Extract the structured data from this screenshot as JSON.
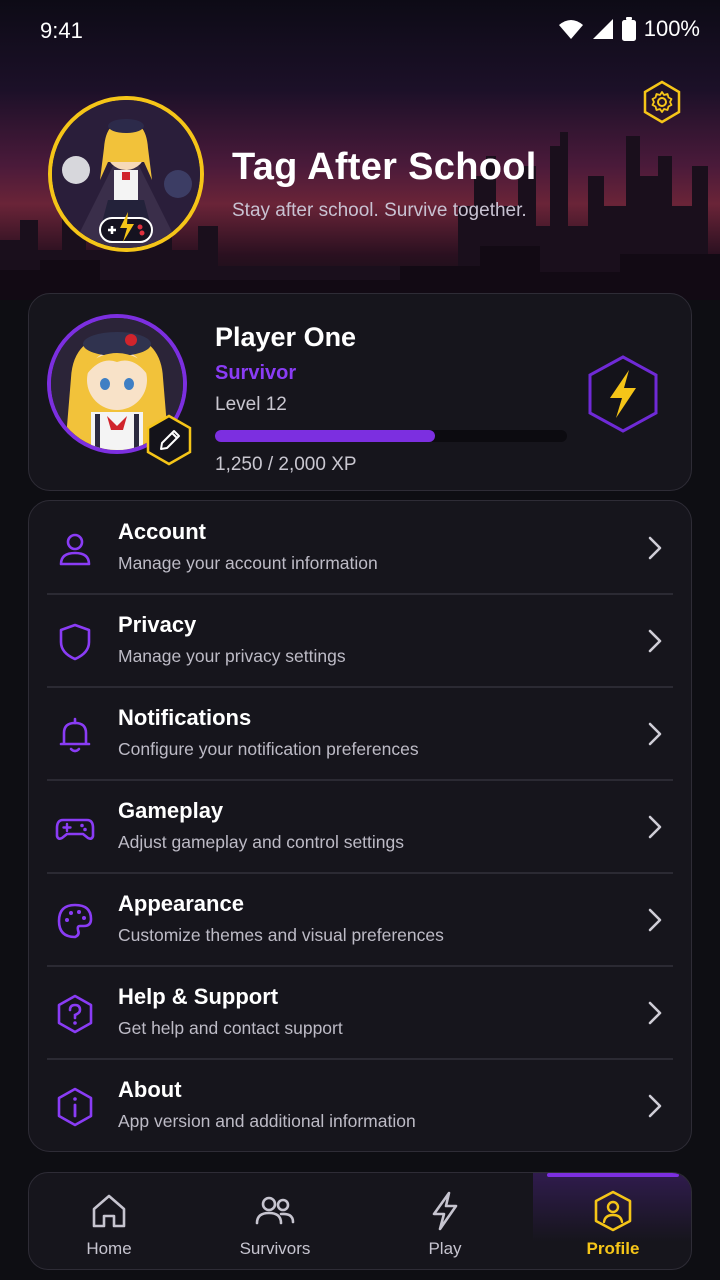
{
  "status_bar": {
    "time": "9:41",
    "battery": "100%"
  },
  "header": {
    "title": "Tag After School",
    "subtitle": "Stay after school. Survive together."
  },
  "profile": {
    "name": "Player One",
    "rank": "Survivor",
    "level": "Level 12",
    "xp_text": "1,250 / 2,000 XP",
    "xp_progress": 0.625
  },
  "settings": [
    {
      "title": "Account",
      "subtitle": "Manage your account information",
      "icon": "user-icon"
    },
    {
      "title": "Privacy",
      "subtitle": "Manage your privacy settings",
      "icon": "shield-icon"
    },
    {
      "title": "Notifications",
      "subtitle": "Configure your notification preferences",
      "icon": "bell-icon"
    },
    {
      "title": "Gameplay",
      "subtitle": "Adjust gameplay and control settings",
      "icon": "gamepad-icon"
    },
    {
      "title": "Appearance",
      "subtitle": "Customize themes and visual preferences",
      "icon": "palette-icon"
    },
    {
      "title": "Help & Support",
      "subtitle": "Get help and contact support",
      "icon": "help-icon"
    },
    {
      "title": "About",
      "subtitle": "App version and additional information",
      "icon": "info-icon"
    }
  ],
  "nav": [
    {
      "label": "Home",
      "icon": "home-icon"
    },
    {
      "label": "Survivors",
      "icon": "users-icon"
    },
    {
      "label": "Play",
      "icon": "lightning-icon"
    },
    {
      "label": "Profile",
      "icon": "profile-icon",
      "active": true
    }
  ],
  "colors": {
    "accent_purple": "#7c2fe0",
    "accent_yellow": "#f5c518",
    "background": "#0e0e13",
    "card": "#16151c"
  }
}
